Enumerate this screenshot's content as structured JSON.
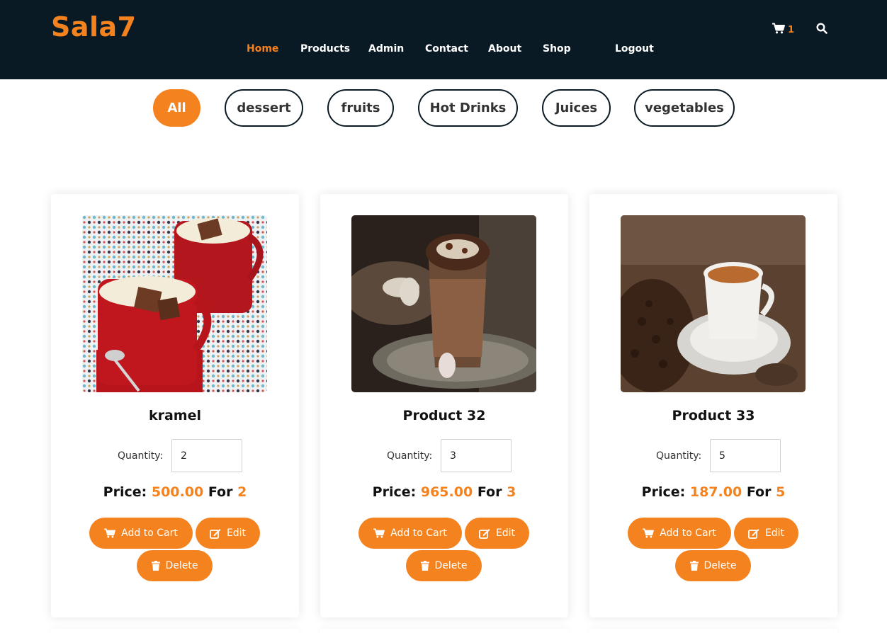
{
  "header": {
    "logo": "Sala7",
    "nav": [
      "Home",
      "Products",
      "Admin",
      "Contact",
      "About",
      "Shop",
      "Logout"
    ],
    "active_nav": "Home",
    "cart_count": "1",
    "cart_icon": "shopping-cart-icon",
    "search_icon": "search-icon"
  },
  "filters": [
    "All",
    "dessert",
    "fruits",
    "Hot Drinks",
    "Juices",
    "vegetables"
  ],
  "active_filter": "All",
  "colors": {
    "accent": "#f4821f",
    "header_bg": "#0a1a24"
  },
  "products": [
    {
      "name": "kramel",
      "quantity_label": "Quantity:",
      "quantity": "2",
      "price_label": "Price:",
      "price": "500.00",
      "for_label": "For",
      "for_qty": "2",
      "add_to_cart": "Add to Cart",
      "edit": "Edit",
      "delete": "Delete"
    },
    {
      "name": "Product 32",
      "quantity_label": "Quantity:",
      "quantity": "3",
      "price_label": "Price:",
      "price": "965.00",
      "for_label": "For",
      "for_qty": "3",
      "add_to_cart": "Add to Cart",
      "edit": "Edit",
      "delete": "Delete"
    },
    {
      "name": "Product 33",
      "quantity_label": "Quantity:",
      "quantity": "5",
      "price_label": "Price:",
      "price": "187.00",
      "for_label": "For",
      "for_qty": "5",
      "add_to_cart": "Add to Cart",
      "edit": "Edit",
      "delete": "Delete"
    }
  ]
}
